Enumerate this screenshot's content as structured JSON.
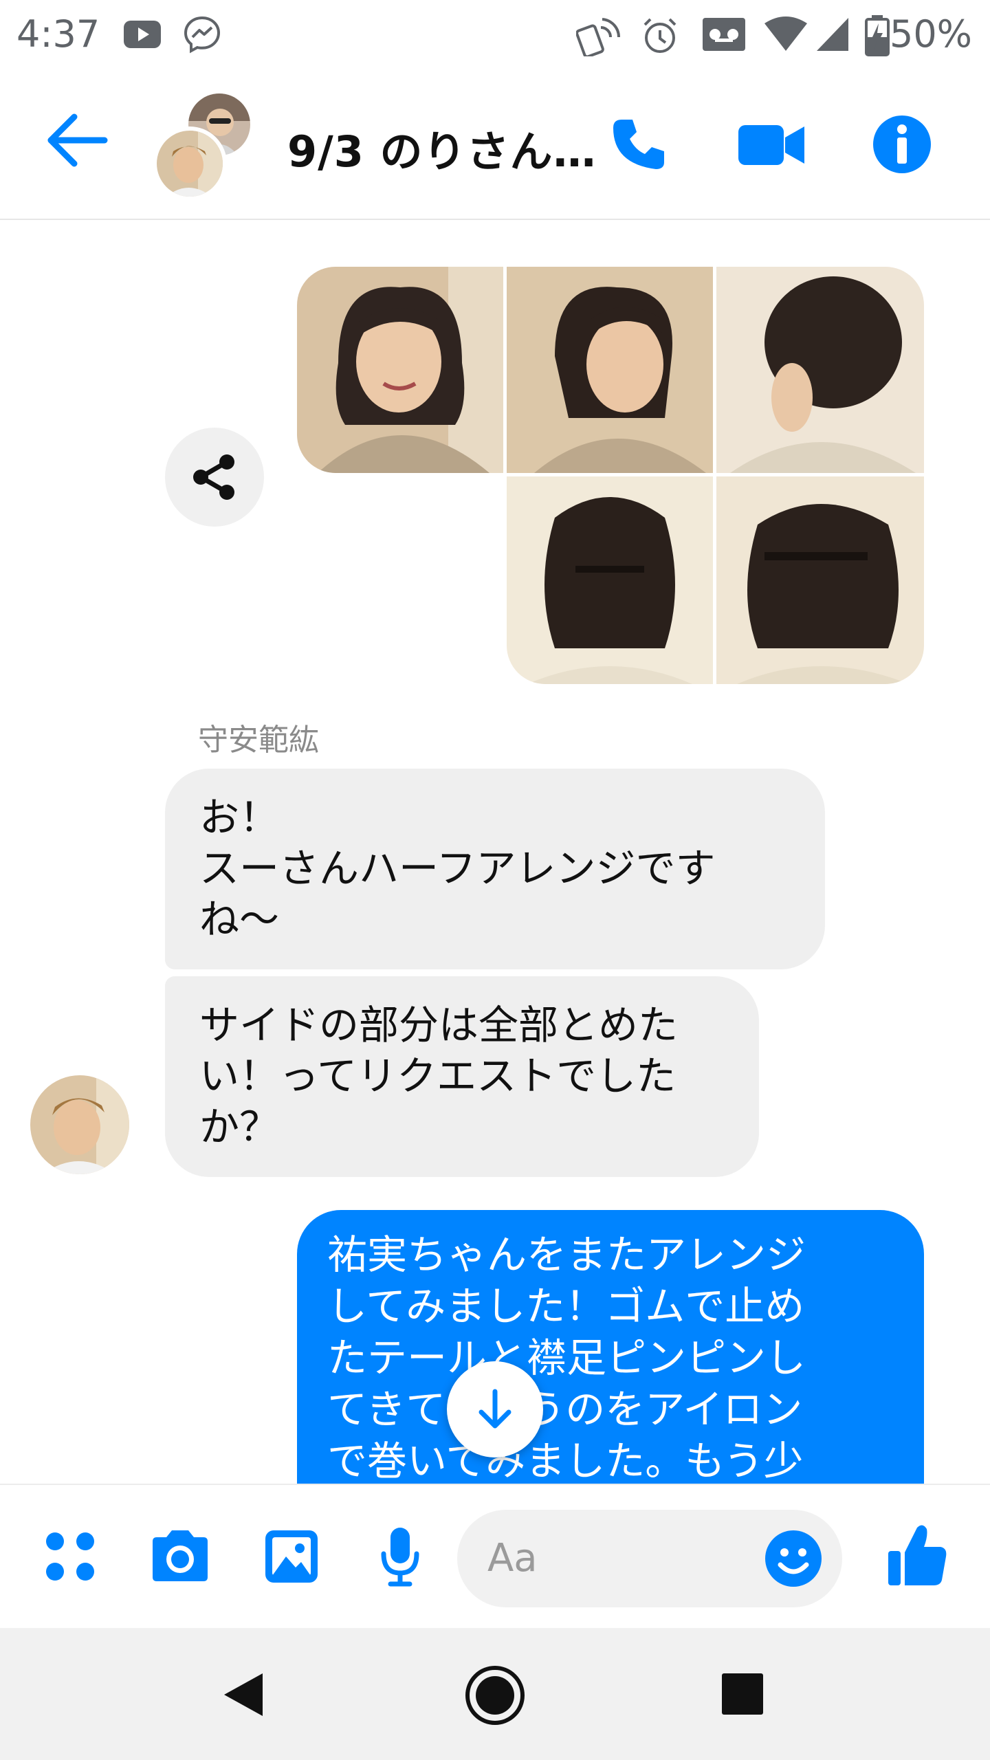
{
  "status_bar": {
    "time": "4:37",
    "battery": "50%",
    "icons": [
      "youtube-icon",
      "messenger-icon",
      "nfc-icon",
      "alarm-icon",
      "voicemail-icon",
      "wifi-icon",
      "signal-icon",
      "battery-icon"
    ]
  },
  "header": {
    "title": "9/3 のりさん…",
    "actions": [
      "back-arrow-icon",
      "phone-icon",
      "video-camera-icon",
      "info-icon"
    ]
  },
  "thread": {
    "sender_name": "守安範紘",
    "incoming": [
      "お！\nスーさんハーフアレンジです\nね〜",
      "サイドの部分は全部とめた\nい！ってリクエストでした\nか？"
    ],
    "outgoing": "祐実ちゃんをまたアレンジ\nしてみました！ゴムで止め\nたテールと襟足ピンピンし\nてきてたとうのをアイロン\nで巻いてみました。もう少"
  },
  "composer": {
    "placeholder": "Aa",
    "icons": [
      "apps-icon",
      "camera-icon",
      "gallery-icon",
      "microphone-icon",
      "emoji-icon",
      "thumbs-up-icon"
    ]
  },
  "colors": {
    "accent": "#0084ff",
    "incoming_bubble": "#efefef",
    "nav_bar": "#f1f1f1"
  }
}
